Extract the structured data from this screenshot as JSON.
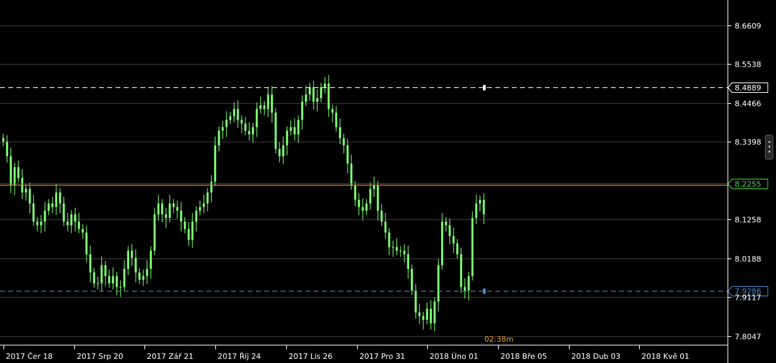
{
  "chart_data": {
    "type": "candlestick",
    "title": "",
    "xlabel": "",
    "ylabel": "",
    "ylim": [
      7.78,
      8.73
    ],
    "y_ticks": [
      "8.6609",
      "8.5538",
      "8.4466",
      "8.3398",
      "8.1258",
      "8.0188",
      "7.9117",
      "7.8047"
    ],
    "x_ticks": [
      "2017 Čer 18",
      "2017 Srp 20",
      "2017 Zář 21",
      "2017 Říj 24",
      "2017 Lis 26",
      "2017 Pro 31",
      "2018 Úno 01",
      "2018 Bře 05",
      "2018 Dub 03",
      "2018 Kvě 01"
    ],
    "series": [
      {
        "values": [
          8.34,
          8.3,
          8.22,
          8.27,
          8.24,
          8.2,
          8.21,
          8.17,
          8.12,
          8.11,
          8.12,
          8.15,
          8.17,
          8.16,
          8.2,
          8.17,
          8.12,
          8.11,
          8.14,
          8.12,
          8.1,
          8.09,
          8.03,
          7.98,
          7.95,
          7.95,
          8.0,
          7.97,
          7.95,
          7.97,
          7.94,
          7.94,
          7.99,
          8.04,
          8.02,
          7.98,
          7.96,
          7.97,
          7.99,
          8.04,
          8.14,
          8.17,
          8.14,
          8.13,
          8.17,
          8.16,
          8.15,
          8.12,
          8.1,
          8.07,
          8.12,
          8.15,
          8.16,
          8.17,
          8.2,
          8.23,
          8.33,
          8.37,
          8.38,
          8.4,
          8.41,
          8.43,
          8.4,
          8.39,
          8.37,
          8.36,
          8.38,
          8.43,
          8.44,
          8.43,
          8.47,
          8.42,
          8.32,
          8.3,
          8.33,
          8.37,
          8.38,
          8.36,
          8.4,
          8.45,
          8.47,
          8.49,
          8.45,
          8.46,
          8.49,
          8.5,
          8.43,
          8.42,
          8.38,
          8.35,
          8.33,
          8.28,
          8.22,
          8.18,
          8.16,
          8.15,
          8.17,
          8.21,
          8.22,
          8.15,
          8.12,
          8.09,
          8.05,
          8.05,
          8.04,
          8.04,
          8.03,
          7.99,
          7.93,
          7.87,
          7.86,
          7.85,
          7.88,
          7.84,
          7.9,
          8.0,
          8.12,
          8.11,
          8.08,
          8.06,
          8.03,
          7.94,
          7.93,
          7.97,
          8.13,
          8.17,
          8.18,
          8.14
        ]
      }
    ],
    "lines": [
      {
        "value": 8.4889,
        "label": "8.4889",
        "style": "dashed",
        "color": "#ffffff"
      },
      {
        "value": 8.2255,
        "label": "8.2255",
        "style": "solid",
        "color": "#c0302a"
      },
      {
        "value": 7.9286,
        "label": "7.9286",
        "style": "dashed",
        "color": "#4a88c8"
      }
    ],
    "timer": "02:38m",
    "grid": true,
    "legend": "none"
  },
  "colors": {
    "background": "#000000",
    "candle": "#7cff70",
    "grid": "#3a3a3a",
    "axis": "#ffffff",
    "timer": "#e0a030",
    "current_price": "#40d040"
  }
}
